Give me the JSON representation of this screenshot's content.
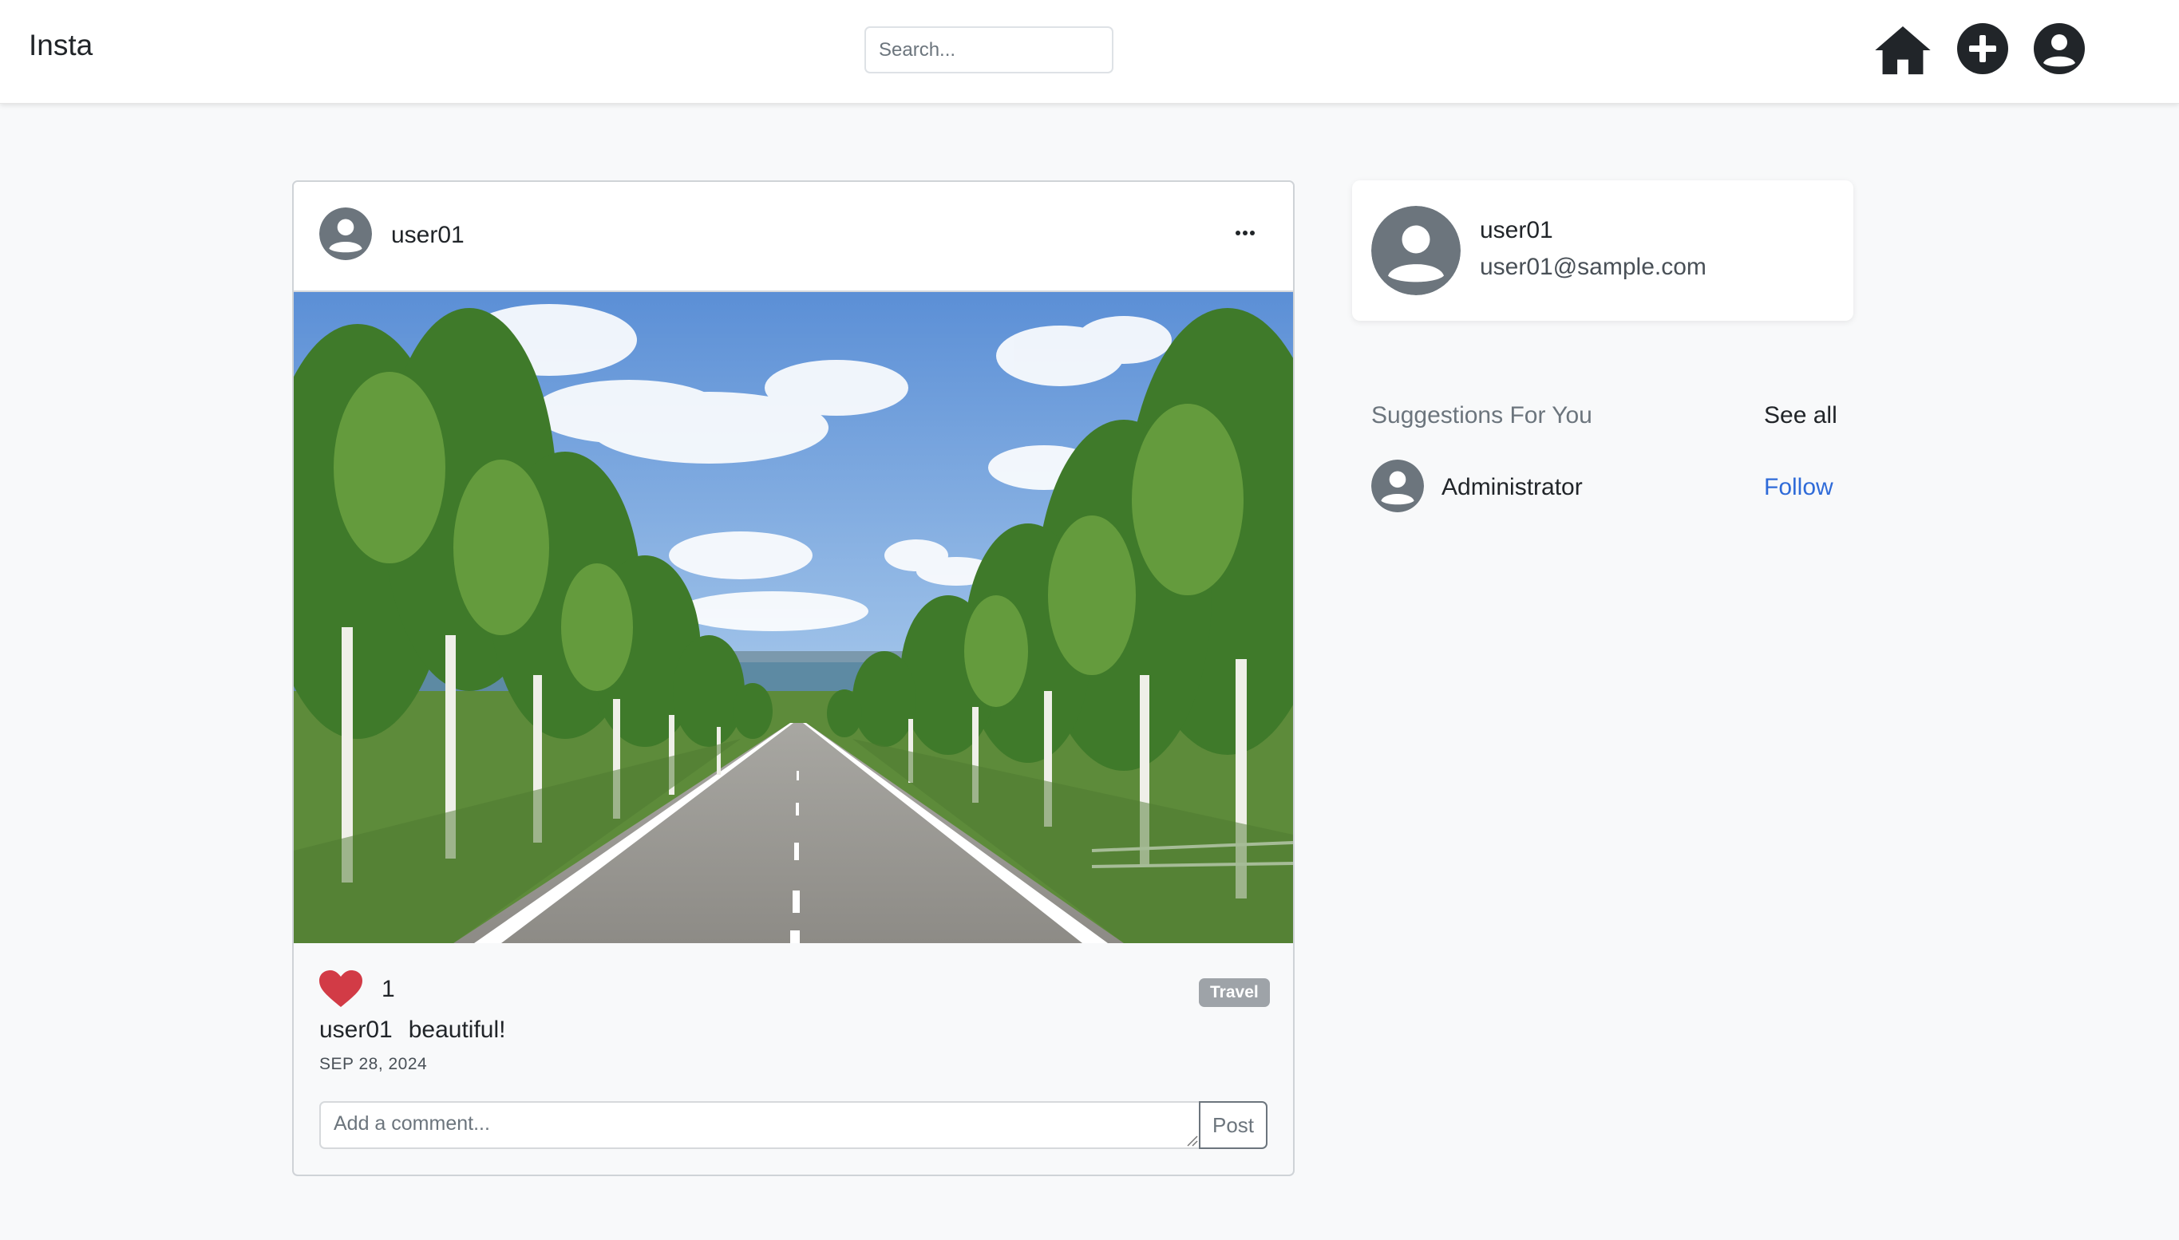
{
  "navbar": {
    "brand": "Insta",
    "search_placeholder": "Search...",
    "icons": [
      "home-icon",
      "plus-circle-icon",
      "user-circle-icon"
    ]
  },
  "post": {
    "username": "user01",
    "image_description_alt": "",
    "likes": "1",
    "tag": "Travel",
    "caption_user": "user01",
    "caption_text": "beautiful!",
    "date": "SEP 28, 2024",
    "comment_placeholder": "Add a comment...",
    "post_button": "Post"
  },
  "profile": {
    "name": "user01",
    "email": "user01@sample.com"
  },
  "suggestions": {
    "title": "Suggestions For You",
    "see_all": "See all",
    "items": [
      {
        "name": "Administrator",
        "action": "Follow"
      }
    ]
  },
  "colors": {
    "like": "#d23b46",
    "follow_link": "#2f6bd8",
    "badge": "#9ea3a8",
    "avatar": "#6c757d"
  }
}
